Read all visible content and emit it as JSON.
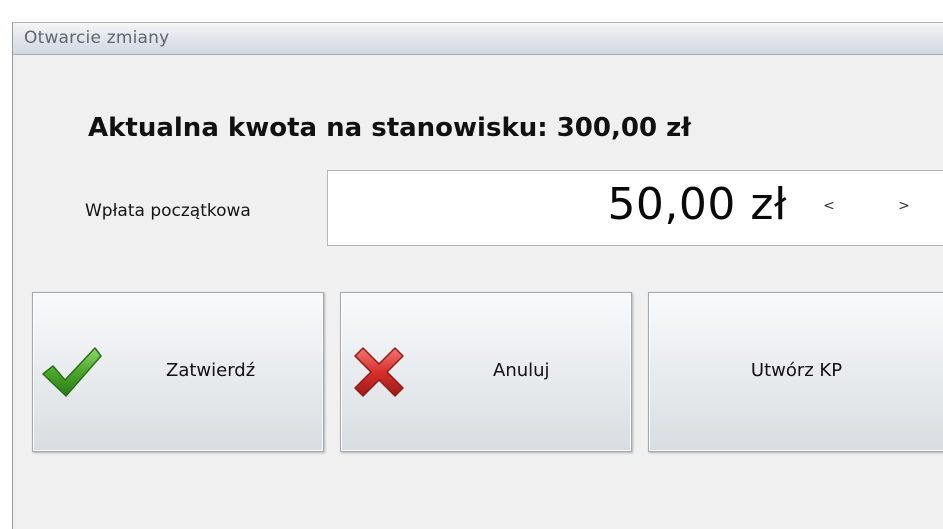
{
  "window": {
    "title": "Otwarcie zmiany"
  },
  "main": {
    "headline": "Aktualna kwota na stanowisku: 300,00 zł",
    "amount_field": {
      "label": "Wpłata początkowa",
      "value": "50,00 zł",
      "decrease_label": "<",
      "increase_label": ">"
    }
  },
  "buttons": {
    "confirm": {
      "label": "Zatwierdź",
      "icon": "check-icon"
    },
    "cancel": {
      "label": "Anuluj",
      "icon": "close-icon"
    },
    "create_kp": {
      "label": "Utwórz KP"
    }
  },
  "colors": {
    "check_green": "#4aa82a",
    "cross_red": "#d8302c",
    "title_text": "#5f6670"
  }
}
